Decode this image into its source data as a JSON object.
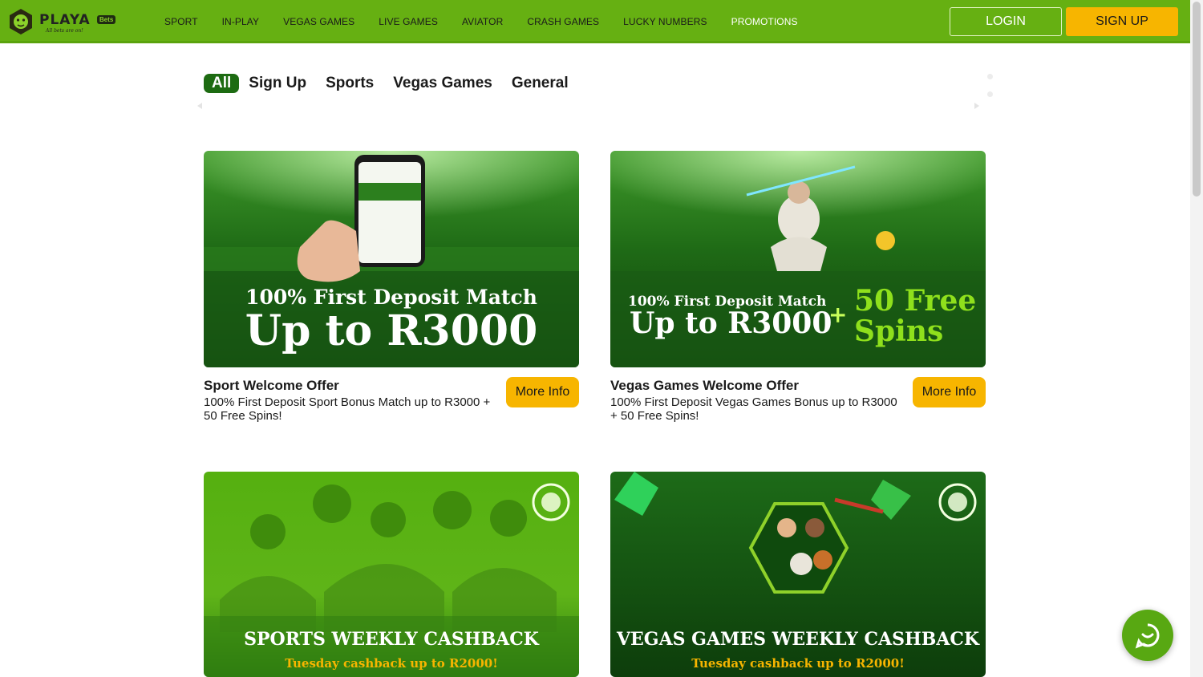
{
  "brand": {
    "name": "PLAYA",
    "badge": "Bets",
    "tagline": "All bets are on!"
  },
  "nav": [
    {
      "label": "SPORT"
    },
    {
      "label": "IN-PLAY"
    },
    {
      "label": "VEGAS GAMES"
    },
    {
      "label": "LIVE GAMES"
    },
    {
      "label": "AVIATOR"
    },
    {
      "label": "CRASH GAMES"
    },
    {
      "label": "LUCKY NUMBERS"
    },
    {
      "label": "PROMOTIONS",
      "active": true
    }
  ],
  "auth": {
    "login_label": "LOGIN",
    "signup_label": "SIGN UP"
  },
  "tabs": [
    {
      "label": "All",
      "active": true
    },
    {
      "label": "Sign Up"
    },
    {
      "label": "Sports"
    },
    {
      "label": "Vegas Games"
    },
    {
      "label": "General"
    }
  ],
  "promotions": [
    {
      "banner_line1": "100% First Deposit Match",
      "banner_line2": "Up to R3000",
      "title": "Sport Welcome Offer",
      "description": "100% First Deposit Sport Bonus Match up to R3000 + 50 Free Spins!",
      "button_label": "More Info"
    },
    {
      "banner_line1": "100% First Deposit Match",
      "banner_line2": "Up to R3000",
      "banner_plus": "+",
      "banner_extra1": "50 Free",
      "banner_extra2": "Spins",
      "title": "Vegas Games Welcome Offer",
      "description": "100% First Deposit Vegas Games Bonus up to R3000 + 50 Free Spins!",
      "button_label": "More Info"
    },
    {
      "banner_line1": "SPORTS WEEKLY CASHBACK",
      "banner_line2": "Tuesday cashback up to R2000!"
    },
    {
      "banner_line1": "VEGAS GAMES WEEKLY CASHBACK",
      "banner_line2": "Tuesday cashback up to R2000!"
    }
  ],
  "colors": {
    "header_green": "#66b012",
    "accent_yellow": "#f7b500",
    "tab_active": "#1d6b12"
  }
}
